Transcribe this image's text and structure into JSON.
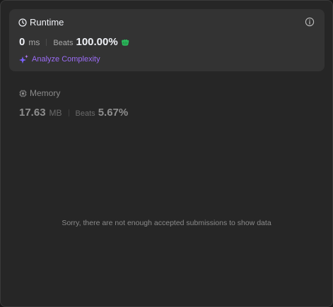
{
  "runtime": {
    "title": "Runtime",
    "value": "0",
    "unit": "ms",
    "beats_label": "Beats",
    "beats_pct": "100.00%",
    "analyze_label": "Analyze Complexity"
  },
  "memory": {
    "title": "Memory",
    "value": "17.63",
    "unit": "MB",
    "beats_label": "Beats",
    "beats_pct": "5.67%"
  },
  "empty_message": "Sorry, there are not enough accepted submissions to show data",
  "colors": {
    "accent_purple": "#9b6cf5",
    "medal_green": "#2cbb5d"
  }
}
